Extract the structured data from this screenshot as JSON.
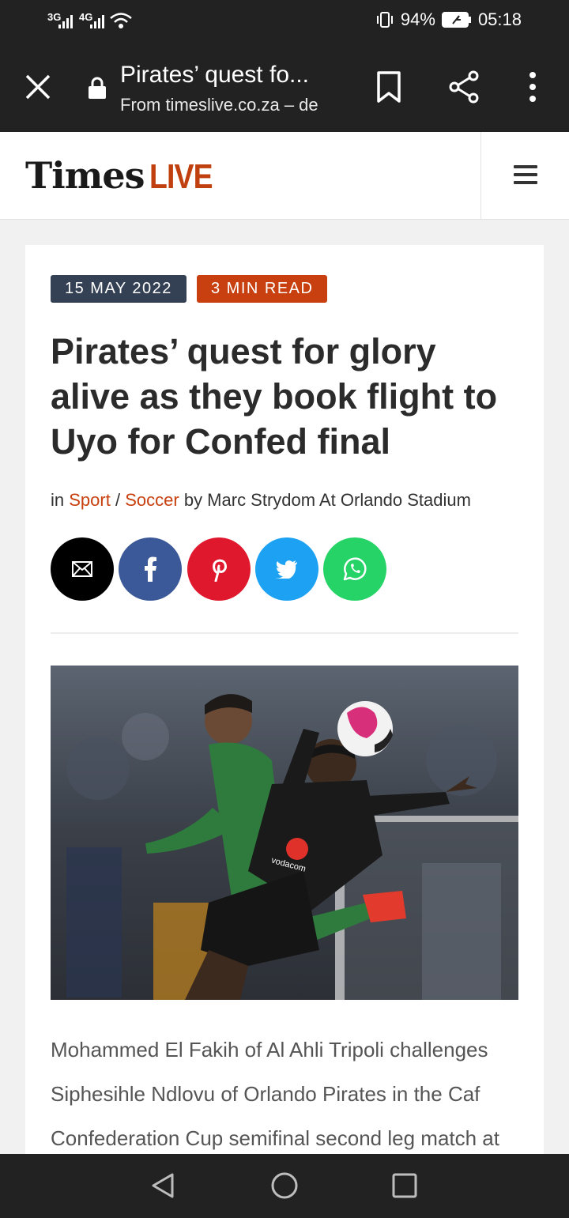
{
  "status_bar": {
    "network1": "3G",
    "network2": "4G",
    "battery": "94%",
    "time": "05:18"
  },
  "toolbar": {
    "title": "Pirates’ quest fo...",
    "subtitle": "From timeslive.co.za – de"
  },
  "site": {
    "logo_part1": "Times",
    "logo_part2": "LIVE"
  },
  "article": {
    "date": "15 MAY 2022",
    "read_time": "3 MIN READ",
    "headline": "Pirates’ quest for glory alive as they book flight to Uyo for Confed final",
    "byline_in": "in",
    "category1": "Sport",
    "separator": "/",
    "category2": "Soccer",
    "byline_by": "by Marc Strydom At Orlando Stadium",
    "caption": "Mohammed El Fakih of Al Ahli Tripoli challenges Siphesihle Ndlovu of Orlando Pirates in the Caf Confederation Cup semifinal second leg match at",
    "photo_sponsor": "vodacom"
  },
  "share": [
    {
      "icon": "email-icon",
      "color": "#000000"
    },
    {
      "icon": "facebook-icon",
      "color": "#3b5998"
    },
    {
      "icon": "pinterest-icon",
      "color": "#e0182d"
    },
    {
      "icon": "twitter-icon",
      "color": "#1da1f2"
    },
    {
      "icon": "whatsapp-icon",
      "color": "#25d366"
    }
  ],
  "colors": {
    "accent": "#c8400f",
    "date_tag": "#344054",
    "chrome": "#222222"
  }
}
